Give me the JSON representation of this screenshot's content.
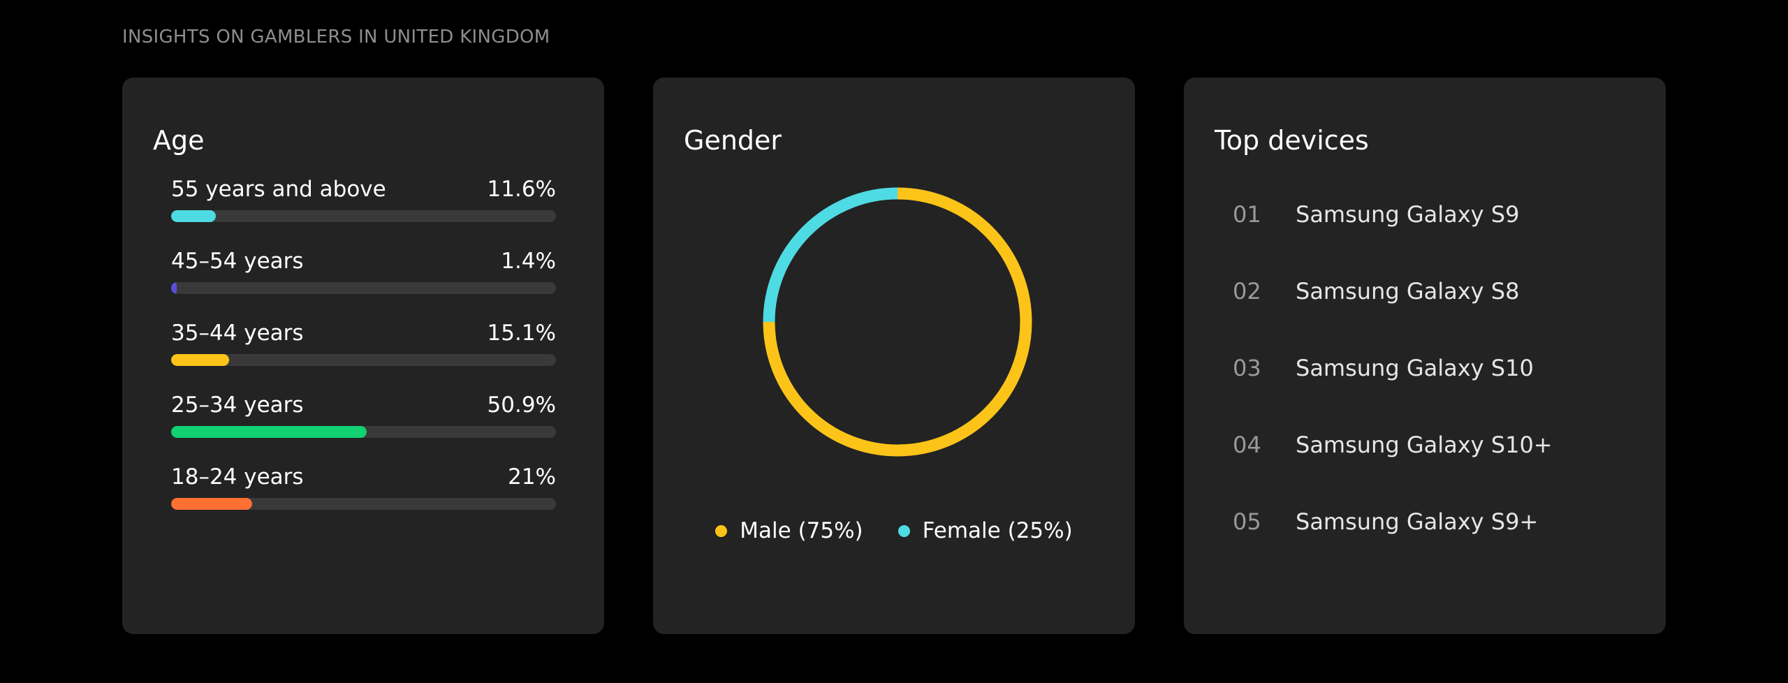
{
  "page": {
    "title": "INSIGHTS ON GAMBLERS IN UNITED KINGDOM"
  },
  "age": {
    "title": "Age",
    "items": [
      {
        "label": "55 years and above",
        "value_text": "11.6%",
        "fraction": 0.116,
        "color": "#4fdbe3"
      },
      {
        "label": "45–54 years",
        "value_text": "1.4%",
        "fraction": 0.014,
        "color": "#5a4fd6"
      },
      {
        "label": "35–44 years",
        "value_text": "15.1%",
        "fraction": 0.151,
        "color": "#fcc419"
      },
      {
        "label": "25–34 years",
        "value_text": "50.9%",
        "fraction": 0.509,
        "color": "#12d173"
      },
      {
        "label": "18–24 years",
        "value_text": "21%",
        "fraction": 0.21,
        "color": "#ff7033"
      }
    ]
  },
  "gender": {
    "title": "Gender",
    "segments": [
      {
        "label": "Male (75%)",
        "fraction": 0.75,
        "color": "#fcc419"
      },
      {
        "label": "Female (25%)",
        "fraction": 0.25,
        "color": "#4fdbe3"
      }
    ]
  },
  "devices": {
    "title": "Top devices",
    "items": [
      {
        "rank": "01",
        "name": "Samsung Galaxy S9"
      },
      {
        "rank": "02",
        "name": "Samsung Galaxy S8"
      },
      {
        "rank": "03",
        "name": "Samsung Galaxy S10"
      },
      {
        "rank": "04",
        "name": "Samsung Galaxy S10+"
      },
      {
        "rank": "05",
        "name": "Samsung Galaxy S9+"
      }
    ]
  }
}
